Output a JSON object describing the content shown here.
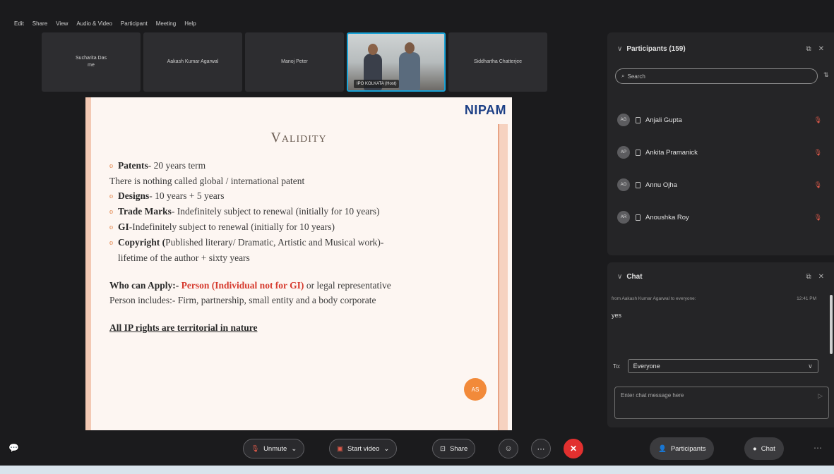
{
  "menubar": [
    "Edit",
    "Share",
    "View",
    "Audio & Video",
    "Participant",
    "Meeting",
    "Help"
  ],
  "video_strip": [
    {
      "name": "Sucharita Das",
      "sub": "me"
    },
    {
      "name": "Aakash Kumar Agarwal"
    },
    {
      "name": "Manoj Peter"
    },
    {
      "name": "IPO KOLKATA (Host)",
      "active": true
    },
    {
      "name": "Siddhartha Chatterjee"
    }
  ],
  "slide": {
    "logo": "NIPAM",
    "title": "Validity",
    "lines": [
      {
        "bullet": true,
        "key": "Patents",
        "text": "- 20 years term"
      },
      {
        "bullet": false,
        "key": "",
        "text": "There is nothing called global / international patent"
      },
      {
        "bullet": true,
        "key": "Designs",
        "text": "- 10 years + 5 years"
      },
      {
        "bullet": true,
        "key": "Trade Marks",
        "text": "- Indefinitely subject to renewal (initially for 10 years)"
      },
      {
        "bullet": true,
        "key": "GI",
        "text": "-Indefinitely subject to renewal (initially for 10 years)"
      },
      {
        "bullet": true,
        "key": "Copyright (",
        "text": "Published literary/ Dramatic, Artistic and Musical work)-"
      },
      {
        "bullet": false,
        "indent": true,
        "key": "",
        "text": "lifetime of the author + sixty years"
      }
    ],
    "apply_label": "Who can Apply:-",
    "apply_red": "Person (Individual not for GI)",
    "apply_rest": " or legal representative",
    "person_includes": "Person includes:- Firm, partnership, small entity and a body corporate",
    "territorial": "All IP rights are territorial in nature",
    "badge": "AS"
  },
  "participants": {
    "title": "Participants (159)",
    "search_placeholder": "Search",
    "people": [
      {
        "initials": "AG",
        "name": "Anjali Gupta"
      },
      {
        "initials": "AP",
        "name": "Ankita Pramanick"
      },
      {
        "initials": "AO",
        "name": "Annu Ojha"
      },
      {
        "initials": "AR",
        "name": "Anoushka Roy"
      }
    ]
  },
  "chat": {
    "title": "Chat",
    "meta_from": "from Aakash Kumar Agarwal to everyone:",
    "meta_time": "12:41 PM",
    "message": "yes",
    "to_label": "To:",
    "to_value": "Everyone",
    "input_placeholder": "Enter chat message here"
  },
  "toolbar": {
    "unmute": "Unmute",
    "start_video": "Start video",
    "share": "Share",
    "participants": "Participants",
    "chat": "Chat"
  },
  "colors": {
    "accent": "#19a2d6",
    "leave": "#e2302f",
    "slide_accent": "#e07b3a",
    "red_text": "#d63b2f"
  }
}
